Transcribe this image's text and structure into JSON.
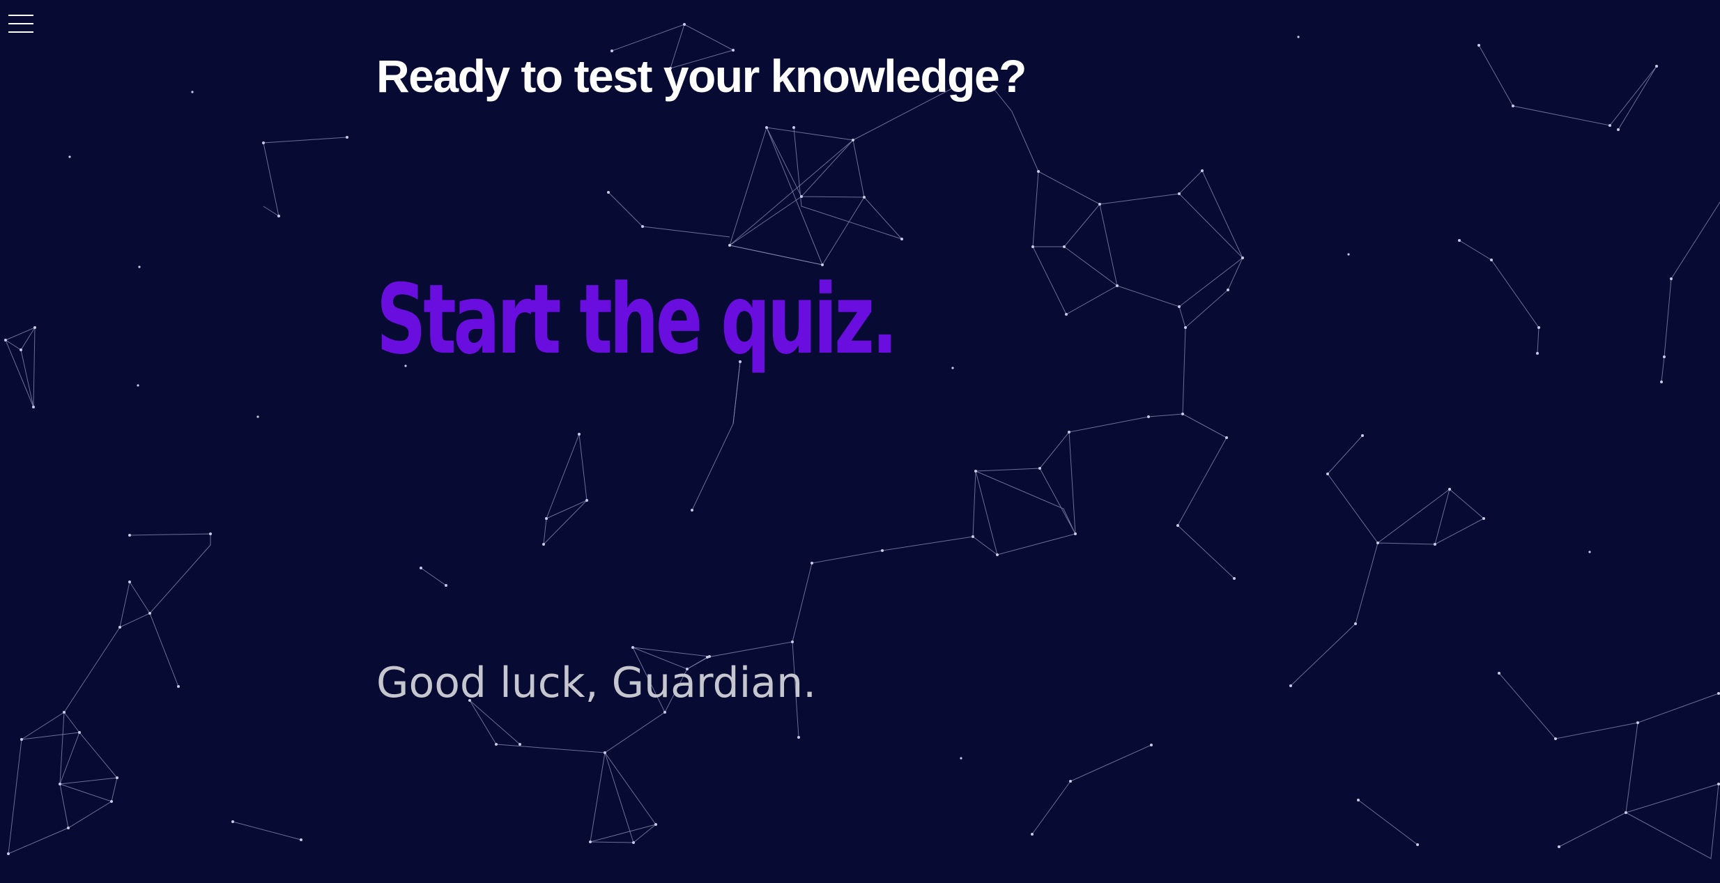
{
  "page": {
    "background_color": "#070a33",
    "network_line_color": "#8e90b8",
    "network_node_color": "#c9cbe6"
  },
  "nav": {
    "menu_icon": "hamburger-menu-icon"
  },
  "hero": {
    "heading": "Ready to test your knowledge?",
    "heading_color": "#ffffff",
    "cta_label": "Start the quiz.",
    "cta_color": "#6a0ee0",
    "tagline": "Good luck, Guardian.",
    "tagline_color": "#c6c6ce"
  }
}
